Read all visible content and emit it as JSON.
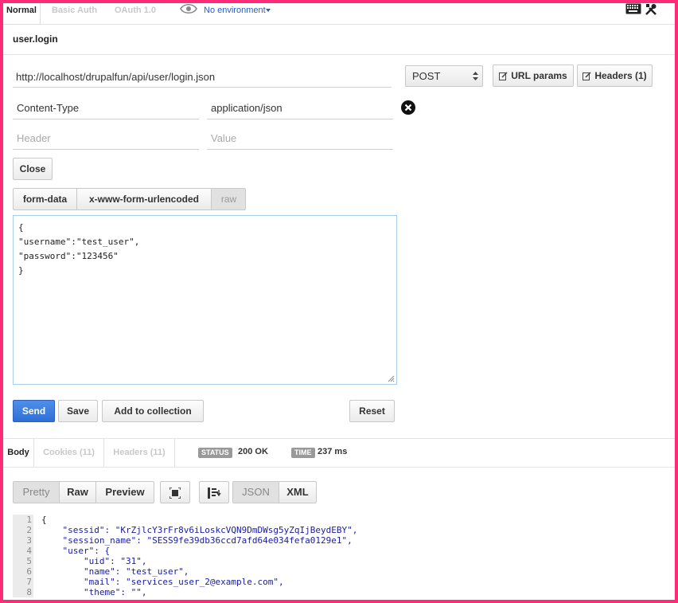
{
  "auth_tabs": [
    {
      "label": "Normal",
      "active": true
    },
    {
      "label": "Basic Auth",
      "active": false
    },
    {
      "label": "OAuth 1.0",
      "active": false
    }
  ],
  "environment": {
    "label": "No environment",
    "icon": "eye-icon"
  },
  "top_icons": [
    "keyboard-icon",
    "tools-icon"
  ],
  "request_name": "user.login",
  "url": {
    "value": "http://localhost/drupalfun/api/user/login.json"
  },
  "method": {
    "selected": "POST"
  },
  "toolbar": {
    "url_params_label": "URL params",
    "headers_label": "Headers (1)"
  },
  "headers": [
    {
      "key": "Content-Type",
      "value": "application/json"
    }
  ],
  "new_header": {
    "key_placeholder": "Header",
    "value_placeholder": "Value"
  },
  "close_label": "Close",
  "body_tabs": [
    {
      "label": "form-data",
      "active": false
    },
    {
      "label": "x-www-form-urlencoded",
      "active": false
    },
    {
      "label": "raw",
      "active": true
    }
  ],
  "raw_body": "{\n\"username\":\"test_user\",\n\"password\":\"123456\"\n}",
  "actions": {
    "send": "Send",
    "save": "Save",
    "add_to_collection": "Add to collection",
    "reset": "Reset"
  },
  "response_tabs": [
    {
      "label": "Body",
      "active": true
    },
    {
      "label": "Cookies (11)",
      "active": false
    },
    {
      "label": "Headers (11)",
      "active": false
    }
  ],
  "status": {
    "badge": "STATUS",
    "value": "200 OK"
  },
  "time": {
    "badge": "TIME",
    "value": "237 ms"
  },
  "view_modes": [
    {
      "label": "Pretty",
      "active": true
    },
    {
      "label": "Raw",
      "active": false
    },
    {
      "label": "Preview",
      "active": false
    }
  ],
  "formats": [
    {
      "label": "JSON",
      "active": true
    },
    {
      "label": "XML",
      "active": false
    }
  ],
  "response_lines": [
    {
      "num": "1",
      "text": "{"
    },
    {
      "num": "2",
      "text": "    \"sessid\": \"KrZjlcY3rFr8v6iLoskcVQN9DmDWsg5yZqIjBeydEBY\","
    },
    {
      "num": "3",
      "text": "    \"session_name\": \"SESS9fe39db36ccd7afd64e034fefa0129e1\","
    },
    {
      "num": "4",
      "text": "    \"user\": {"
    },
    {
      "num": "5",
      "text": "        \"uid\": \"31\","
    },
    {
      "num": "6",
      "text": "        \"name\": \"test_user\","
    },
    {
      "num": "7",
      "text": "        \"mail\": \"services_user_2@example.com\","
    },
    {
      "num": "8",
      "text": "        \"theme\": \"\","
    }
  ],
  "colors": {
    "border": "#ff2b78",
    "accent": "#2e6fd6",
    "link": "#2a5cbf",
    "json_key": "#1a1aa6"
  }
}
